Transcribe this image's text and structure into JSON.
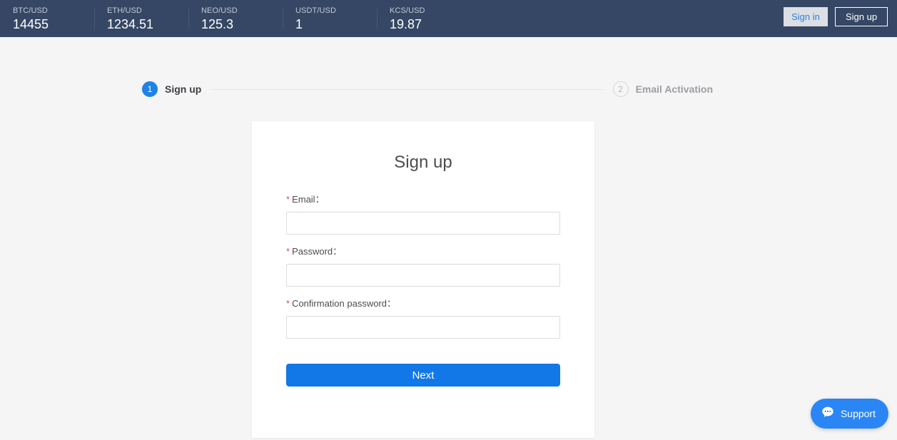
{
  "header": {
    "tickers": [
      {
        "pair": "BTC/USD",
        "price": "14455"
      },
      {
        "pair": "ETH/USD",
        "price": "1234.51"
      },
      {
        "pair": "NEO/USD",
        "price": "125.3"
      },
      {
        "pair": "USDT/USD",
        "price": "1"
      },
      {
        "pair": "KCS/USD",
        "price": "19.87"
      }
    ],
    "sign_in_label": "Sign in",
    "sign_up_label": "Sign up",
    "background_color": "#354764"
  },
  "steps": [
    {
      "number": "1",
      "label": "Sign up",
      "state": "active"
    },
    {
      "number": "2",
      "label": "Email Activation",
      "state": "inactive"
    }
  ],
  "card": {
    "title": "Sign up",
    "fields": [
      {
        "label": "Email：",
        "value": "",
        "placeholder": ""
      },
      {
        "label": "Password：",
        "value": "",
        "placeholder": ""
      },
      {
        "label": "Confirmation password：",
        "value": "",
        "placeholder": ""
      }
    ],
    "required_marker": "*",
    "next_label": "Next",
    "accent_color": "#1278e8"
  },
  "support": {
    "label": "Support",
    "icon": "chat-bubble-icon",
    "color": "#2a86f5"
  }
}
